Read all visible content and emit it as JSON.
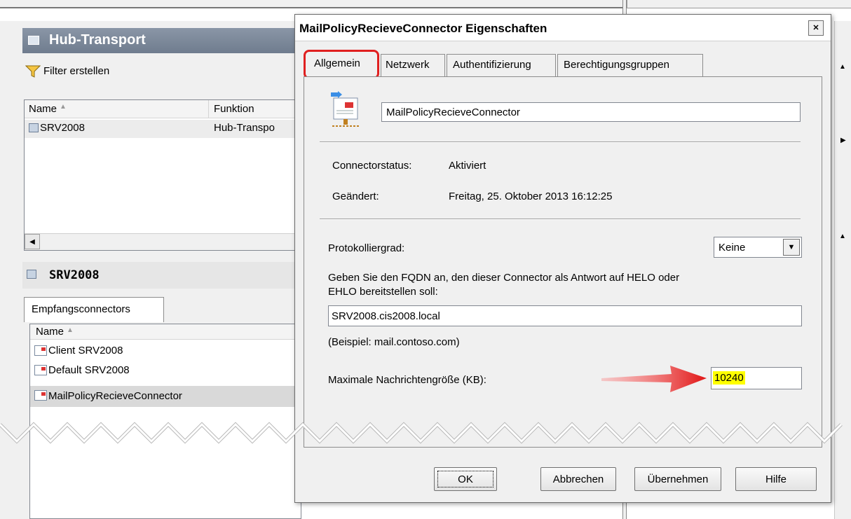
{
  "console": {
    "hub_header": "Hub-Transport",
    "filter_label": "Filter erstellen",
    "server_columns": [
      "Name",
      "Funktion"
    ],
    "servers": [
      {
        "name": "SRV2008",
        "role": "Hub-Transpo"
      }
    ],
    "server_header": "SRV2008",
    "tab_label": "Empfangsconnectors",
    "connector_column": "Name",
    "connectors": [
      {
        "name": "Client SRV2008",
        "selected": false
      },
      {
        "name": "Default SRV2008",
        "selected": false
      },
      {
        "name": "MailPolicyRecieveConnector",
        "selected": true
      }
    ]
  },
  "dialog": {
    "title": "MailPolicyRecieveConnector Eigenschaften",
    "close_glyph": "✕",
    "tabs": [
      {
        "label": "Allgemein",
        "active": true
      },
      {
        "label": "Netzwerk",
        "active": false
      },
      {
        "label": "Authentifizierung",
        "active": false
      },
      {
        "label": "Berechtigungsgruppen",
        "active": false
      }
    ],
    "name_value": "MailPolicyRecieveConnector",
    "status_label": "Connectorstatus:",
    "status_value": "Aktiviert",
    "changed_label": "Geändert:",
    "changed_value": "Freitag, 25. Oktober 2013 16:12:25",
    "log_label": "Protokolliergrad:",
    "log_value": "Keine",
    "fqdn_text_1": "Geben Sie den FQDN an, den dieser Connector als Antwort auf HELO oder",
    "fqdn_text_2": "EHLO bereitstellen soll:",
    "fqdn_value": "SRV2008.cis2008.local",
    "example_text": "(Beispiel: mail.contoso.com)",
    "maxsize_label": "Maximale Nachrichtengröße (KB):",
    "maxsize_value": "10240",
    "buttons": {
      "ok": "OK",
      "cancel": "Abbrechen",
      "apply": "Übernehmen",
      "help": "Hilfe"
    }
  },
  "colors": {
    "highlight_circle": "#e02020",
    "arrow": "#ee1c1c",
    "value_highlight": "#ffff00",
    "header_bg": "#7a8798"
  }
}
